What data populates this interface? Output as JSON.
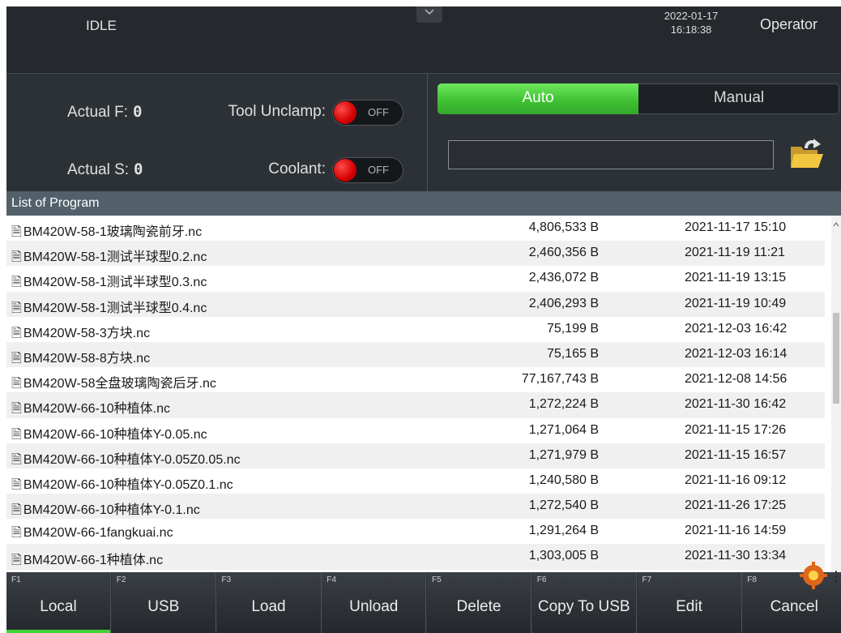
{
  "status": {
    "state": "IDLE",
    "date": "2022-01-17",
    "time": "16:18:38",
    "user": "Operator"
  },
  "controls": {
    "actual_f_label": "Actual F:",
    "actual_f_value": "0",
    "actual_s_label": "Actual S:",
    "actual_s_value": "0",
    "tool_unclamp_label": "Tool Unclamp:",
    "tool_unclamp_state": "OFF",
    "coolant_label": "Coolant:",
    "coolant_state": "OFF",
    "mode_auto": "Auto",
    "mode_manual": "Manual",
    "selected_mode": "Auto",
    "program_path": ""
  },
  "list": {
    "title": "List of Program",
    "files": [
      {
        "name": "BM420W-58-1玻璃陶瓷前牙.nc",
        "size": "4,806,533 B",
        "date": "2021-11-17  15:10"
      },
      {
        "name": "BM420W-58-1测试半球型0.2.nc",
        "size": "2,460,356 B",
        "date": "2021-11-19  11:21"
      },
      {
        "name": "BM420W-58-1测试半球型0.3.nc",
        "size": "2,436,072 B",
        "date": "2021-11-19  13:15"
      },
      {
        "name": "BM420W-58-1测试半球型0.4.nc",
        "size": "2,406,293 B",
        "date": "2021-11-19  10:49"
      },
      {
        "name": "BM420W-58-3方块.nc",
        "size": "75,199 B",
        "date": "2021-12-03  16:42"
      },
      {
        "name": "BM420W-58-8方块.nc",
        "size": "75,165 B",
        "date": "2021-12-03  16:14"
      },
      {
        "name": "BM420W-58全盘玻璃陶瓷后牙.nc",
        "size": "77,167,743 B",
        "date": "2021-12-08  14:56"
      },
      {
        "name": "BM420W-66-10种植体.nc",
        "size": "1,272,224 B",
        "date": "2021-11-30  16:42"
      },
      {
        "name": "BM420W-66-10种植体Y-0.05.nc",
        "size": "1,271,064 B",
        "date": "2021-11-15  17:26"
      },
      {
        "name": "BM420W-66-10种植体Y-0.05Z0.05.nc",
        "size": "1,271,979 B",
        "date": "2021-11-15  16:57"
      },
      {
        "name": "BM420W-66-10种植体Y-0.05Z0.1.nc",
        "size": "1,240,580 B",
        "date": "2021-11-16  09:12"
      },
      {
        "name": "BM420W-66-10种植体Y-0.1.nc",
        "size": "1,272,540 B",
        "date": "2021-11-26  17:25"
      },
      {
        "name": "BM420W-66-1fangkuai.nc",
        "size": "1,291,264 B",
        "date": "2021-11-16  14:59"
      },
      {
        "name": "BM420W-66-1种植体.nc",
        "size": "1,303,005 B",
        "date": "2021-11-30  13:34"
      }
    ]
  },
  "function_keys": [
    {
      "key": "F1",
      "label": "Local",
      "active": true
    },
    {
      "key": "F2",
      "label": "USB",
      "active": false
    },
    {
      "key": "F3",
      "label": "Load",
      "active": false
    },
    {
      "key": "F4",
      "label": "Unload",
      "active": false
    },
    {
      "key": "F5",
      "label": "Delete",
      "active": false
    },
    {
      "key": "F6",
      "label": "Copy To USB",
      "active": false
    },
    {
      "key": "F7",
      "label": "Edit",
      "active": false
    },
    {
      "key": "F8",
      "label": "Cancel",
      "active": false
    }
  ],
  "icons": [
    "chevron-down-icon",
    "folder-open-icon",
    "document-icon",
    "scroll-up-arrow-icon",
    "gear-icon"
  ],
  "colors": {
    "accent_green": "#3fc233",
    "toggle_off_red": "#d40000",
    "header_bg": "#25292e",
    "list_header_bg": "#52606a"
  }
}
